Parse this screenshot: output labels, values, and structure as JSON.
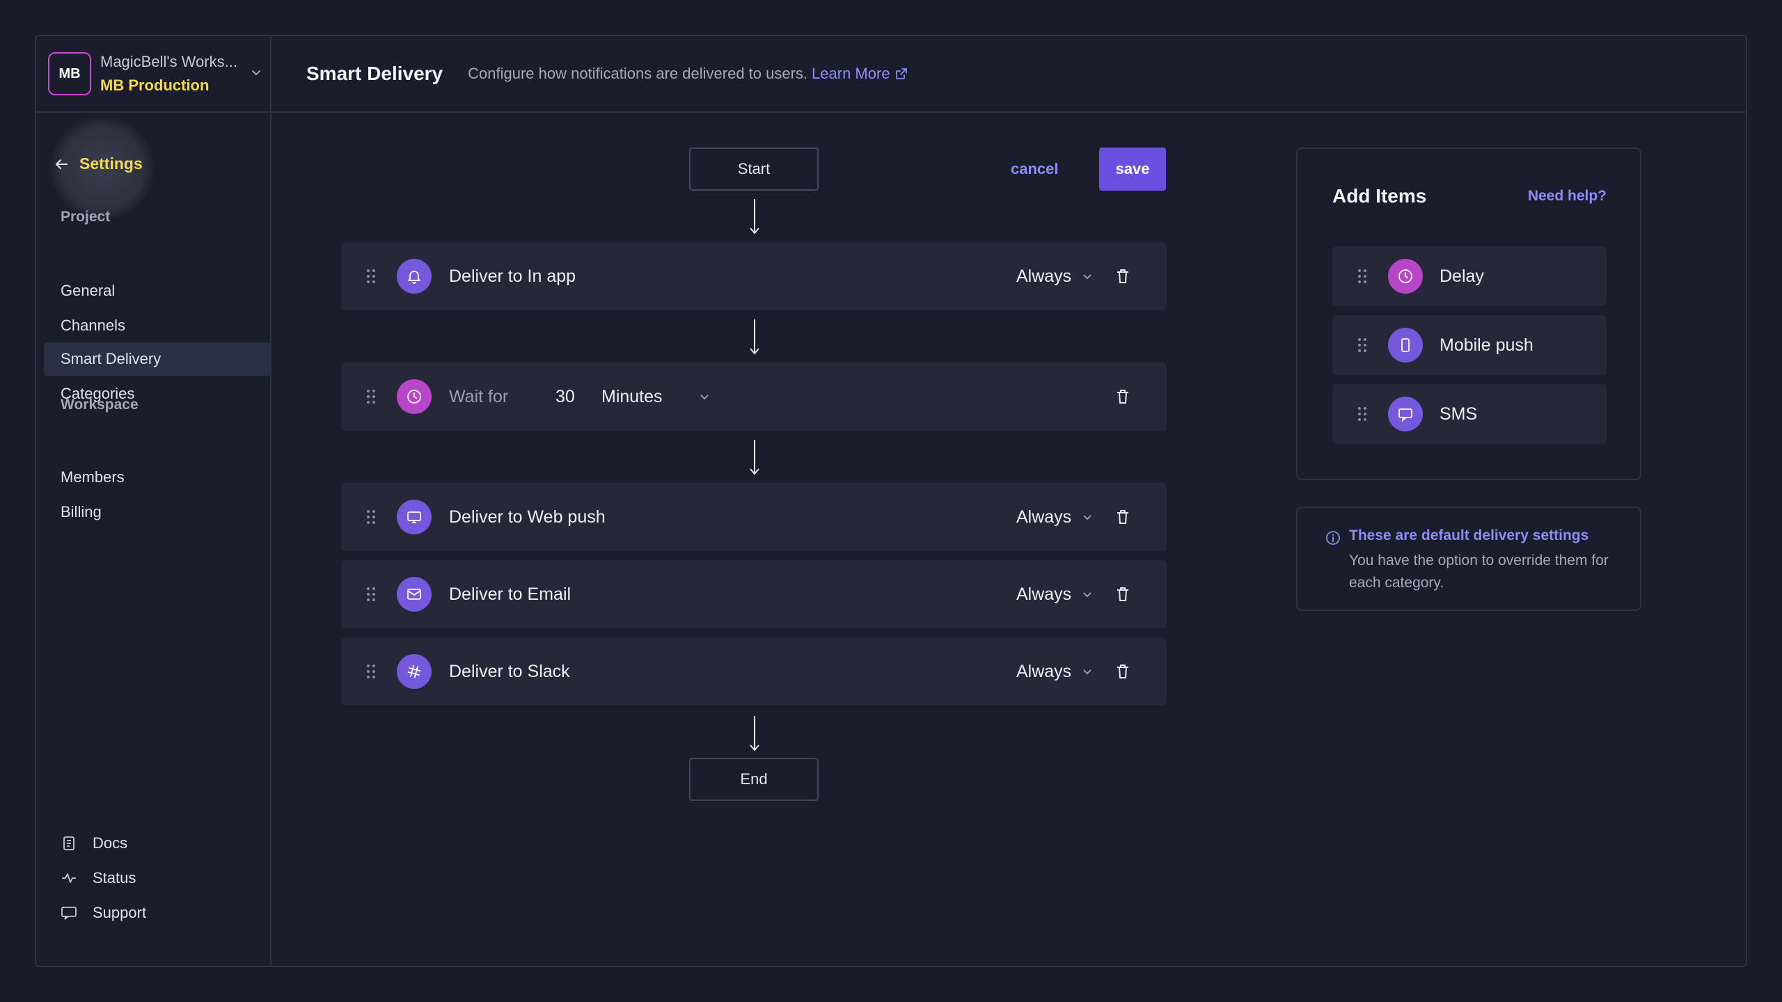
{
  "workspace": {
    "avatar": "MB",
    "name": "MagicBell's Works...",
    "project": "MB Production"
  },
  "sidebar": {
    "back_label": "Settings",
    "sections": [
      {
        "title": "Project",
        "items": [
          "General",
          "Channels",
          "Smart Delivery",
          "Categories"
        ]
      },
      {
        "title": "Workspace",
        "items": [
          "Members",
          "Billing"
        ]
      }
    ],
    "active_item": "Smart Delivery",
    "footer": [
      {
        "label": "Docs",
        "icon": "docs-icon"
      },
      {
        "label": "Status",
        "icon": "activity-icon"
      },
      {
        "label": "Support",
        "icon": "chat-icon"
      }
    ]
  },
  "header": {
    "title": "Smart Delivery",
    "description": "Configure how notifications are delivered to users.",
    "link": "Learn More"
  },
  "flow": {
    "start": "Start",
    "end": "End",
    "cancel": "cancel",
    "save": "save",
    "steps": [
      {
        "label": "Deliver to In app",
        "condition": "Always",
        "icon": "bell-icon"
      },
      {
        "label": "Wait for",
        "value": "30",
        "unit": "Minutes",
        "icon": "clock-icon"
      },
      {
        "label": "Deliver to Web push",
        "condition": "Always",
        "icon": "monitor-icon"
      },
      {
        "label": "Deliver to Email",
        "condition": "Always",
        "icon": "mail-icon"
      },
      {
        "label": "Deliver to Slack",
        "condition": "Always",
        "icon": "slack-icon"
      }
    ]
  },
  "add_items": {
    "title": "Add Items",
    "help": "Need help?",
    "items": [
      {
        "label": "Delay",
        "icon": "clock-icon"
      },
      {
        "label": "Mobile push",
        "icon": "phone-icon"
      },
      {
        "label": "SMS",
        "icon": "message-icon"
      }
    ]
  },
  "info": {
    "title": "These are default delivery settings",
    "body": "You have the option to override them for each category."
  },
  "colors": {
    "accent": "#6b4fe0",
    "link": "#8f8cf6",
    "project_yellow": "#f2d94e",
    "delay_pink": "#b846c8"
  }
}
